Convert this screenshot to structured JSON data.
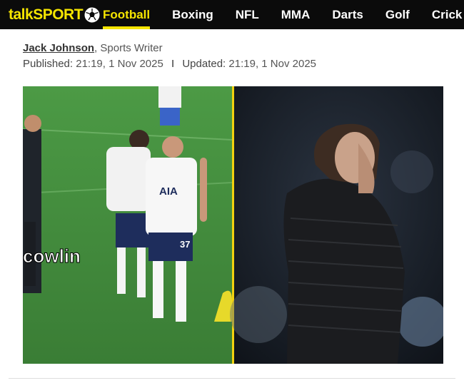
{
  "header": {
    "logo": {
      "talk": "talk",
      "sport": "SPORT",
      "icon": "football-icon"
    },
    "nav": [
      {
        "label": "Football",
        "active": true
      },
      {
        "label": "Boxing",
        "active": false
      },
      {
        "label": "NFL",
        "active": false
      },
      {
        "label": "MMA",
        "active": false
      },
      {
        "label": "Darts",
        "active": false
      },
      {
        "label": "Golf",
        "active": false
      },
      {
        "label": "Crick",
        "active": false
      }
    ]
  },
  "article": {
    "author": "Jack Johnson",
    "author_role": ", Sports Writer",
    "published_label": "Published:",
    "published_value": "21:19, 1 Nov 2025",
    "separator": "I",
    "updated_label": "Updated:",
    "updated_value": "21:19, 1 Nov 2025"
  },
  "image": {
    "overlay_text": "cowlin",
    "shirt_sponsor": "AIA",
    "shirt_number": "37"
  },
  "colors": {
    "brand_yellow": "#f5e500",
    "nav_bg": "#0b0b0b",
    "pitch_green": "#3f8a3a",
    "divider_yellow": "#f2d20f"
  }
}
